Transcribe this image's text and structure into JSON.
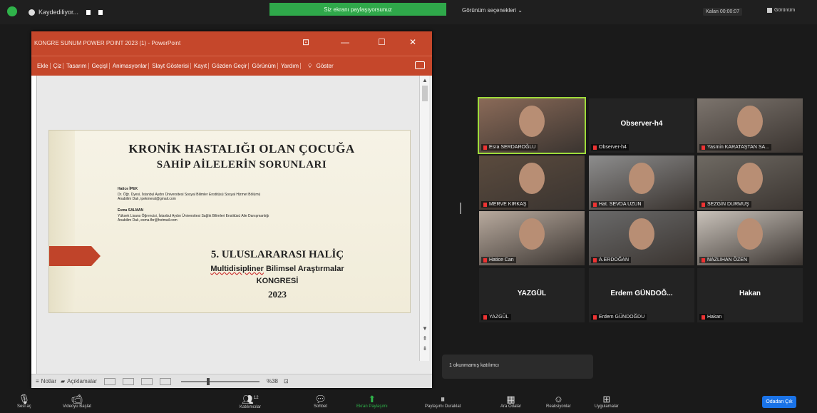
{
  "topbar": {
    "recording_label": "Kaydediliyor...",
    "share_banner": "Siz ekranı paylaşıyorsunuz",
    "view_options": "Görünüm seçenekleri ⌄",
    "remaining": "Kalan 00:00:07",
    "view_label": "Görünüm"
  },
  "ppt": {
    "title": "KONGRE SUNUM POWER POINT 2023 (1) - PowerPoint",
    "menu": [
      "Ekle",
      "Çiz",
      "Tasarım",
      "Geçişl",
      "Animasyonlar",
      "Slayt Gösterisi",
      "Kayıt",
      "Gözden Geçir",
      "Görünüm",
      "Yardım"
    ],
    "tell_me": "Göster",
    "slide": {
      "title1": "KRONİK HASTALIĞI OLAN ÇOCUĞA",
      "title2": "SAHİP AİLELERİN SORUNLARI",
      "author1_name": "Hatice İPEK",
      "author1_info": "Dr. Öğr. Üyesi, İstanbul Aydın Üniversitesi Sosyal Bilimler Enstitüsü Sosyal Hizmet Bölümü",
      "author1_mail": "Anabilim Dalı, ipekmeral@gmail.com",
      "author2_name": "Esma SALMAN",
      "author2_info": "Yüksek Lisans Öğrencisi, İstanbul Aydın Üniversitesi Sağlık Bilimleri Enstitüsü Aile Danışmanlığı",
      "author2_mail": "Anabilim Dalı, esma.fbr@hotmail.com",
      "congress_line1": "5. ULUSLARARASI HALİÇ",
      "congress_line2a": "Multidisipliner",
      "congress_line2b": " Bilimsel Araştırmalar",
      "congress_line3": "KONGRESİ",
      "congress_line4": "2023"
    },
    "status": {
      "notes": "Notlar",
      "comments": "Açıklamalar",
      "zoom": "%38"
    }
  },
  "gallery": [
    {
      "name": "Esra SERDAROĞLU",
      "video": true,
      "active": true
    },
    {
      "name": "Observer-h4",
      "center_name": "Observer-h4",
      "video": false
    },
    {
      "name": "Yasmin KARATAŞTAN SA...",
      "video": true
    },
    {
      "name": "MERVE KIRKAŞ",
      "video": true
    },
    {
      "name": "Hat. SEVDA UZUN",
      "video": true
    },
    {
      "name": "SEZGİN DURMUŞ",
      "video": true
    },
    {
      "name": "Hatice Can",
      "video": true
    },
    {
      "name": "A.ERDOĞAN",
      "video": true
    },
    {
      "name": "NAZLIHAN ÖZEN",
      "video": true
    },
    {
      "name": "YAZGÜL",
      "center_name": "YAZGÜL",
      "video": false
    },
    {
      "name": "Erdem GÜNDOĞDU",
      "center_name": "Erdem GÜNDOĞ...",
      "video": false
    },
    {
      "name": "Hakan",
      "center_name": "Hakan",
      "video": false
    }
  ],
  "chat_notice": "1 okunmamış katılımcı",
  "toolbar": {
    "mute": "Sesi aç",
    "video": "Videoyu Başlat",
    "participants": "Katılımcılar",
    "participants_count": "12",
    "chat": "Sohbet",
    "share": "Ekran Paylaşımı",
    "pause_share": "Paylaşımı Duraklat",
    "breakout": "Ara Odalar",
    "reactions": "Reaksiyonlar",
    "apps": "Uygulamalar",
    "end": "Odadan Çık"
  }
}
